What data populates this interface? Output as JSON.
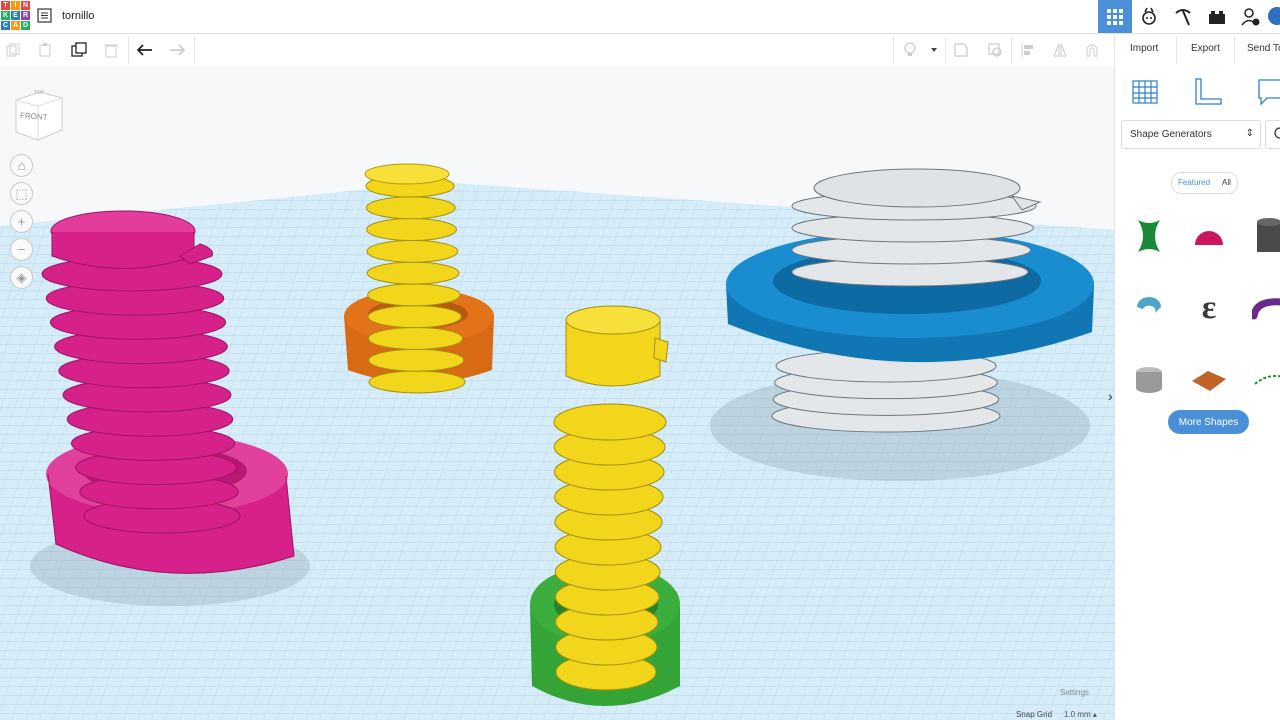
{
  "app": {
    "logo_letters": [
      "T",
      "I",
      "N",
      "K",
      "E",
      "R",
      "C",
      "A",
      "D"
    ],
    "logo_colors": [
      "#e8453c",
      "#f39c12",
      "#e8453c",
      "#27ae60",
      "#2980b9",
      "#8e44ad",
      "#2980b9",
      "#f39c12",
      "#27ae60"
    ],
    "title": "tornillo"
  },
  "topbar_icons": [
    "grid-view-icon",
    "robot-view-icon",
    "pickaxe-icon",
    "bricks-icon",
    "add-user-icon"
  ],
  "toolbar": {
    "import_label": "Import",
    "export_label": "Export",
    "send_label": "Send To"
  },
  "viewport": {
    "navcube_label": "FRONT",
    "navcube_top": "TOP",
    "settings_label": "Settings",
    "snap_label": "Snap Grid",
    "snap_value": "1.0 mm ▴"
  },
  "panel": {
    "dropdown_value": "Shape Generators",
    "tab_featured": "Featured",
    "tab_all": "All",
    "more_shapes_label": "More Shapes",
    "shape_icons": [
      "hourglass-shape-icon",
      "dome-shape-icon",
      "cylinder-shape-icon",
      "torus-segment-shape-icon",
      "epsilon-text-shape-icon",
      "tube-bend-shape-icon",
      "coin-stack-shape-icon",
      "tile-shape-icon",
      "arc-dotted-shape-icon"
    ]
  },
  "colors": {
    "accent": "#4a90d9",
    "magenta": "#d6208a",
    "yellow": "#f2d61c",
    "orange": "#e2731a",
    "green": "#3cae3e",
    "blue": "#1587c9",
    "grey": "#dcdfe2",
    "workplane": "#cfe8f5"
  }
}
